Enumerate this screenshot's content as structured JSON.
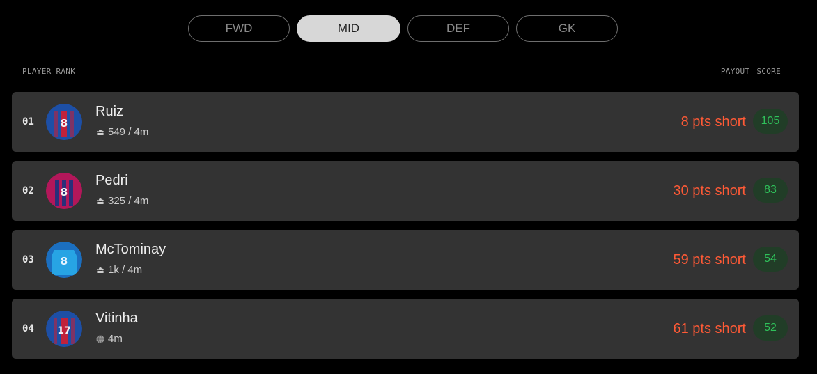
{
  "tabs": [
    {
      "label": "FWD",
      "active": false
    },
    {
      "label": "MID",
      "active": true
    },
    {
      "label": "DEF",
      "active": false
    },
    {
      "label": "GK",
      "active": false
    }
  ],
  "headers": {
    "player_rank": "PLAYER RANK",
    "payout": "PAYOUT",
    "score": "SCORE"
  },
  "players": [
    {
      "rank": "01",
      "name": "Ruiz",
      "meta": "549 / 4m",
      "meta_icon": "users-icon",
      "payout": "8 pts short",
      "score": "105",
      "jersey_number": "8",
      "jersey_colors": [
        "#1d4fa6",
        "#c0223b"
      ]
    },
    {
      "rank": "02",
      "name": "Pedri",
      "meta": "325 / 4m",
      "meta_icon": "users-icon",
      "payout": "30 pts short",
      "score": "83",
      "jersey_number": "8",
      "jersey_colors": [
        "#b3175a",
        "#2a2f7a"
      ]
    },
    {
      "rank": "03",
      "name": "McTominay",
      "meta": "1k / 4m",
      "meta_icon": "users-icon",
      "payout": "59 pts short",
      "score": "54",
      "jersey_number": "8",
      "jersey_colors": [
        "#27a4e4",
        "#1b6fc0"
      ]
    },
    {
      "rank": "04",
      "name": "Vitinha",
      "meta": "4m",
      "meta_icon": "globe-icon",
      "payout": "61 pts short",
      "score": "52",
      "jersey_number": "17",
      "jersey_colors": [
        "#1d4fa6",
        "#c0223b"
      ]
    }
  ],
  "colors": {
    "payout_short": "#ff5a36",
    "score_text": "#2fc15a",
    "score_bg": "#213d27",
    "row_bg": "#333333"
  }
}
